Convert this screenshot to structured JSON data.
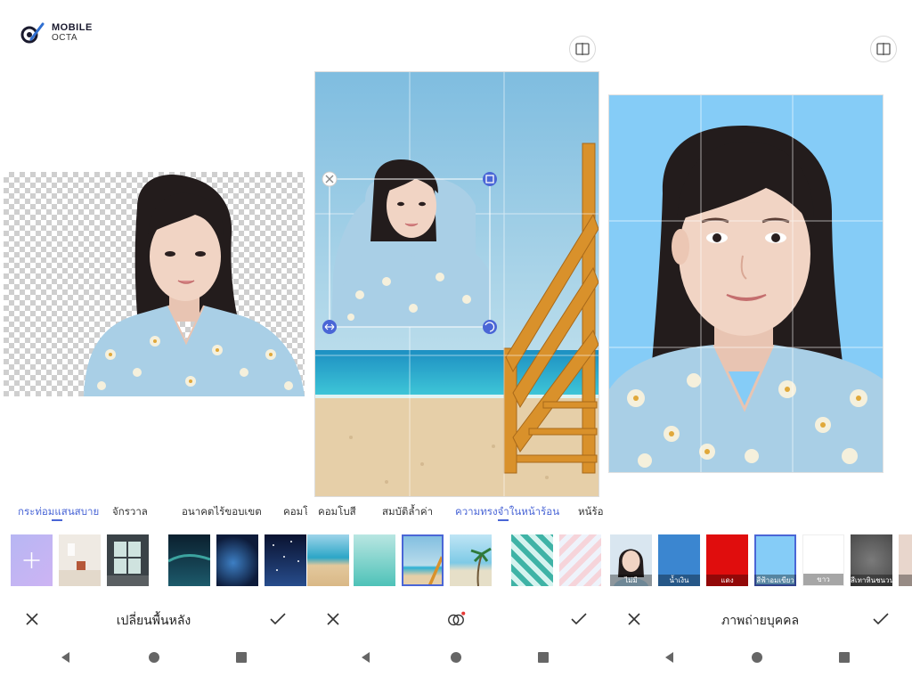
{
  "logo": {
    "line1": "MOBILE",
    "line2": "OCTA"
  },
  "panels": [
    {
      "tabs": [
        {
          "label": "กระท่อมแสนสบาย",
          "active": true
        },
        {
          "label": "จักรวาล",
          "active": false
        },
        {
          "label": "อนาคตไร้ขอบเขต",
          "active": false
        },
        {
          "label": "คอมโ",
          "active": false
        }
      ],
      "action_title": "เปลี่ยนพื้นหลัง"
    },
    {
      "tabs": [
        {
          "label": "คอมโบสี",
          "active": false
        },
        {
          "label": "สมบัติล้ำค่า",
          "active": false
        },
        {
          "label": "ความทรงจำในหน้าร้อน",
          "active": true
        },
        {
          "label": "หน้ร้อ",
          "active": false
        }
      ],
      "action_title": ""
    },
    {
      "swatches": [
        {
          "label": "ไม่มี",
          "color": "#d9e6f0"
        },
        {
          "label": "น้ำเงิน",
          "color": "#3b86d0"
        },
        {
          "label": "แดง",
          "color": "#e00d0d"
        },
        {
          "label": "สีฟ้าอมเขียว",
          "color": "#85ccf7"
        },
        {
          "label": "ขาว",
          "color": "#ffffff"
        },
        {
          "label": "สีเทาหินชนวน",
          "color": "#5c5c5c"
        },
        {
          "label": "สี",
          "color": "#e8d6cc"
        }
      ],
      "action_title": "ภาพถ่ายบุคคล"
    }
  ],
  "colors": {
    "accent": "#4a66d6",
    "sky_blue": "#85ccf7",
    "sea": "#2bb0d4",
    "sand": "#e6cfa8",
    "wood": "#d9912b",
    "dress": "#a9cfe6",
    "hair": "#231c1c",
    "skin": "#f1d4c4"
  }
}
